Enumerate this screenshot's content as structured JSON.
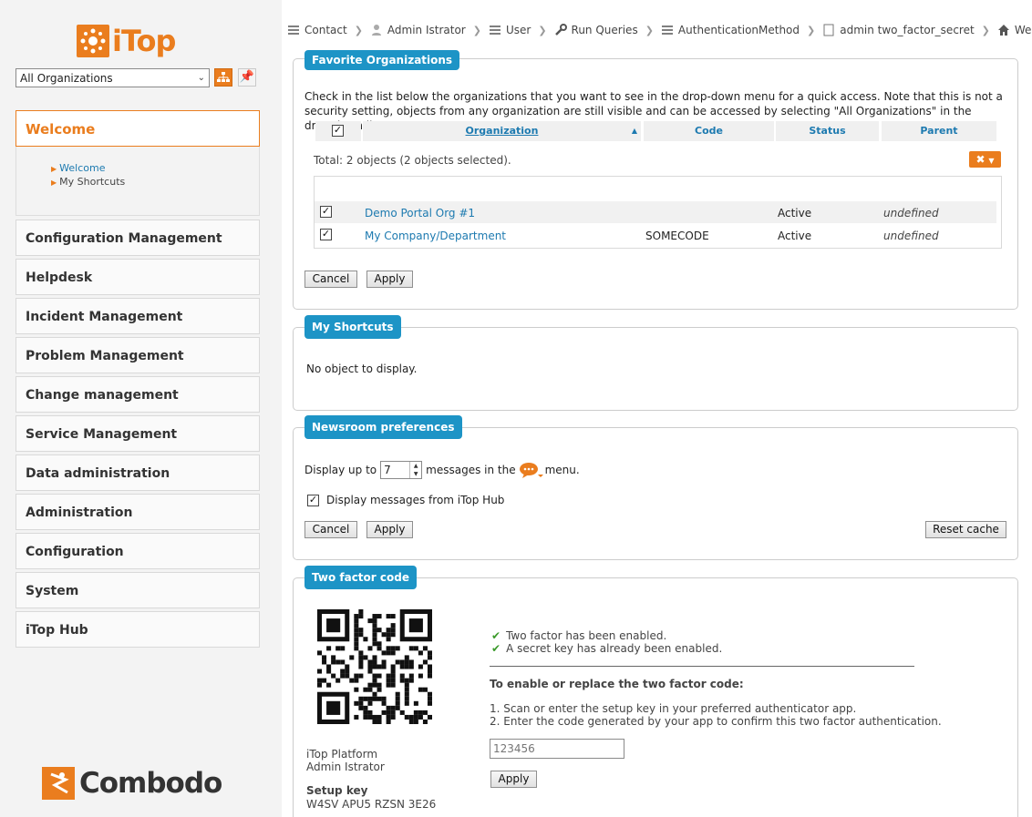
{
  "app": {
    "name": "iTop",
    "vendor": "Combodo"
  },
  "org_selector": {
    "value": "All Organizations"
  },
  "breadcrumb": [
    {
      "label": "Contact",
      "icon": "list-icon"
    },
    {
      "label": "Admin Istrator",
      "icon": "user-icon"
    },
    {
      "label": "User",
      "icon": "list-icon"
    },
    {
      "label": "Run Queries",
      "icon": "wrench-icon"
    },
    {
      "label": "AuthenticationMethod",
      "icon": "list-icon"
    },
    {
      "label": "admin two_factor_secret",
      "icon": "page-icon"
    },
    {
      "label": "Welcome",
      "icon": "home-icon"
    }
  ],
  "menu": {
    "active": "Welcome",
    "sub_items": [
      "Welcome",
      "My Shortcuts"
    ],
    "items": [
      "Configuration Management",
      "Helpdesk",
      "Incident Management",
      "Problem Management",
      "Change management",
      "Service Management",
      "Data administration",
      "Administration",
      "Configuration",
      "System",
      "iTop Hub"
    ]
  },
  "favorites": {
    "title": "Favorite Organizations",
    "description": "Check in the list below the organizations that you want to see in the drop-down menu for a quick access. Note that this is not a security setting, objects from any organization are still visible and can be accessed by selecting \"All Organizations\" in the drop-down list.",
    "total": "Total: 2 objects (2 objects selected).",
    "columns": [
      "Organization",
      "Code",
      "Status",
      "Parent"
    ],
    "rows": [
      {
        "organization": "Demo Portal Org #1",
        "code": "",
        "status": "Active",
        "parent": "undefined"
      },
      {
        "organization": "My Company/Department",
        "code": "SOMECODE",
        "status": "Active",
        "parent": "undefined"
      }
    ],
    "cancel": "Cancel",
    "apply": "Apply"
  },
  "shortcuts": {
    "title": "My Shortcuts",
    "empty": "No object to display."
  },
  "newsroom": {
    "title": "Newsroom preferences",
    "prefix": "Display up to",
    "count": "7",
    "suffix_before": "messages in the",
    "suffix_after": "menu.",
    "hub_label": "Display messages from iTop Hub",
    "cancel": "Cancel",
    "apply": "Apply",
    "reset": "Reset cache"
  },
  "twofactor": {
    "title": "Two factor code",
    "platform": "iTop Platform",
    "user": "Admin Istrator",
    "setup_key_label": "Setup key",
    "setup_key": "W4SV APU5 RZSN 3E26",
    "status1": "Two factor has been enabled.",
    "status2": "A secret key has already been enabled.",
    "heading": "To enable or replace the two factor code:",
    "step1": "1.  Scan or enter the setup key in your preferred authenticator app.",
    "step2": "2.  Enter the code generated by your app to confirm this two factor authentication.",
    "placeholder": "123456",
    "apply": "Apply"
  },
  "colors": {
    "accent": "#ea7d1e",
    "panel_title": "#1d94c6",
    "link": "#1d7ab0",
    "ok": "#3a9a2a"
  }
}
